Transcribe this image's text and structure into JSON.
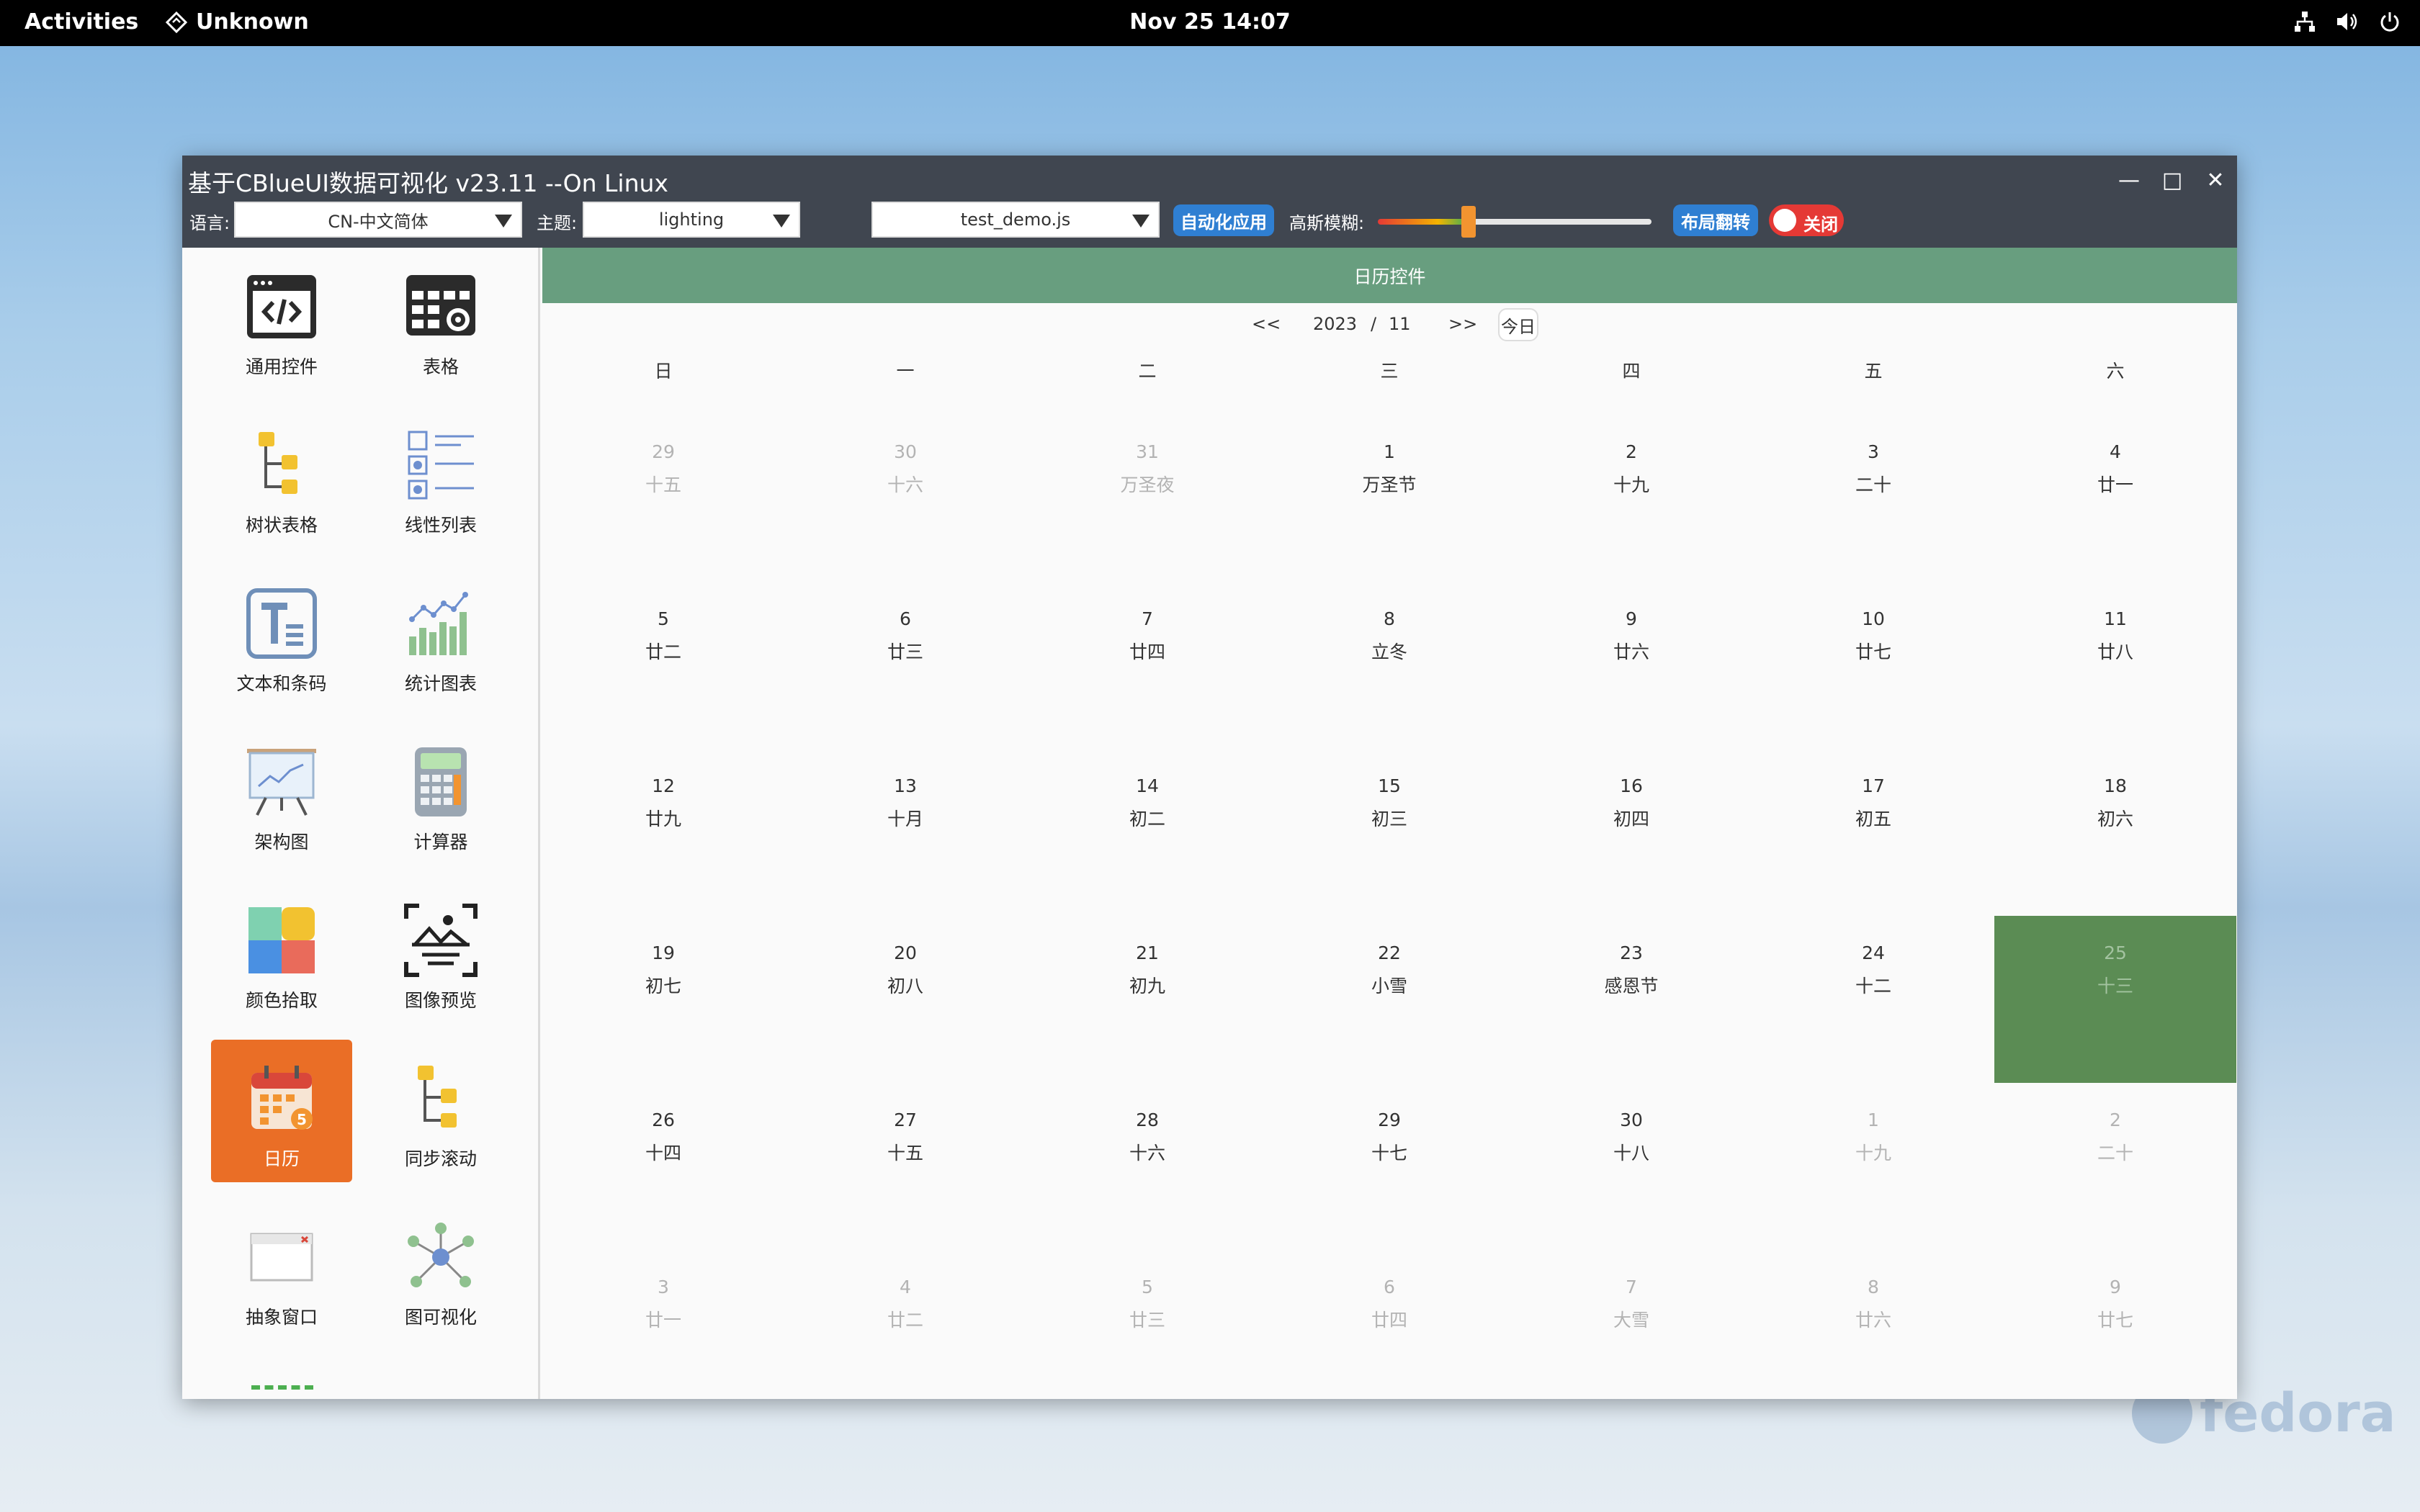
{
  "topbar": {
    "activities": "Activities",
    "app": "Unknown",
    "clock": "Nov 25  14:07"
  },
  "desktop": {
    "watermark": "fedora"
  },
  "window": {
    "title": "基于CBlueUI数据可视化 v23.11 --On Linux"
  },
  "toolbar": {
    "lang_label": "语言:",
    "lang_value": "CN-中文简体",
    "theme_label": "主题:",
    "theme_value": "lighting",
    "script_value": "test_demo.js",
    "auto_btn": "自动化应用",
    "blur_label": "高斯模糊:",
    "blur_level": 0.32,
    "flip_btn": "布局翻转",
    "toggle_label": "关闭"
  },
  "sidebar": {
    "items": [
      {
        "label": "通用控件",
        "icon": "code-window-icon"
      },
      {
        "label": "表格",
        "icon": "table-gear-icon"
      },
      {
        "label": "树状表格",
        "icon": "tree-table-icon"
      },
      {
        "label": "线性列表",
        "icon": "list-icon"
      },
      {
        "label": "文本和条码",
        "icon": "text-icon"
      },
      {
        "label": "统计图表",
        "icon": "chart-icon"
      },
      {
        "label": "架构图",
        "icon": "board-icon"
      },
      {
        "label": "计算器",
        "icon": "calculator-icon"
      },
      {
        "label": "颜色拾取",
        "icon": "palette-icon"
      },
      {
        "label": "图像预览",
        "icon": "image-preview-icon"
      },
      {
        "label": "日历",
        "icon": "calendar-icon",
        "badge": "5"
      },
      {
        "label": "同步滚动",
        "icon": "sync-scroll-icon"
      },
      {
        "label": "抽象窗口",
        "icon": "window-icon"
      },
      {
        "label": "图可视化",
        "icon": "graph-icon"
      }
    ]
  },
  "calendar": {
    "header": "日历控件",
    "prev": "<<",
    "year": "2023",
    "sep": "/",
    "month": "11",
    "next": ">>",
    "today": "今日",
    "weekdays": [
      "日",
      "一",
      "二",
      "三",
      "四",
      "五",
      "六"
    ],
    "weeks": [
      [
        {
          "d": "29",
          "l": "十五",
          "o": true
        },
        {
          "d": "30",
          "l": "十六",
          "o": true
        },
        {
          "d": "31",
          "l": "万圣夜",
          "o": true
        },
        {
          "d": "1",
          "l": "万圣节"
        },
        {
          "d": "2",
          "l": "十九"
        },
        {
          "d": "3",
          "l": "二十"
        },
        {
          "d": "4",
          "l": "廿一"
        }
      ],
      [
        {
          "d": "5",
          "l": "廿二"
        },
        {
          "d": "6",
          "l": "廿三"
        },
        {
          "d": "7",
          "l": "廿四"
        },
        {
          "d": "8",
          "l": "立冬"
        },
        {
          "d": "9",
          "l": "廿六"
        },
        {
          "d": "10",
          "l": "廿七"
        },
        {
          "d": "11",
          "l": "廿八"
        }
      ],
      [
        {
          "d": "12",
          "l": "廿九"
        },
        {
          "d": "13",
          "l": "十月"
        },
        {
          "d": "14",
          "l": "初二"
        },
        {
          "d": "15",
          "l": "初三"
        },
        {
          "d": "16",
          "l": "初四"
        },
        {
          "d": "17",
          "l": "初五"
        },
        {
          "d": "18",
          "l": "初六"
        }
      ],
      [
        {
          "d": "19",
          "l": "初七"
        },
        {
          "d": "20",
          "l": "初八"
        },
        {
          "d": "21",
          "l": "初九"
        },
        {
          "d": "22",
          "l": "小雪"
        },
        {
          "d": "23",
          "l": "感恩节"
        },
        {
          "d": "24",
          "l": "十二"
        },
        {
          "d": "25",
          "l": "十三",
          "s": true
        }
      ],
      [
        {
          "d": "26",
          "l": "十四"
        },
        {
          "d": "27",
          "l": "十五"
        },
        {
          "d": "28",
          "l": "十六"
        },
        {
          "d": "29",
          "l": "十七"
        },
        {
          "d": "30",
          "l": "十八"
        },
        {
          "d": "1",
          "l": "十九",
          "o": true
        },
        {
          "d": "2",
          "l": "二十",
          "o": true
        }
      ],
      [
        {
          "d": "3",
          "l": "廿一",
          "o": true
        },
        {
          "d": "4",
          "l": "廿二",
          "o": true
        },
        {
          "d": "5",
          "l": "廿三",
          "o": true
        },
        {
          "d": "6",
          "l": "廿四",
          "o": true
        },
        {
          "d": "7",
          "l": "大雪",
          "o": true
        },
        {
          "d": "8",
          "l": "廿六",
          "o": true
        },
        {
          "d": "9",
          "l": "廿七",
          "o": true
        }
      ]
    ]
  },
  "colors": {
    "header_green": "#689e7f",
    "selected_green": "#5b8c54",
    "active_orange": "#ea6e26",
    "accent_blue": "#2f7fd2",
    "toggle_red": "#e53935"
  }
}
